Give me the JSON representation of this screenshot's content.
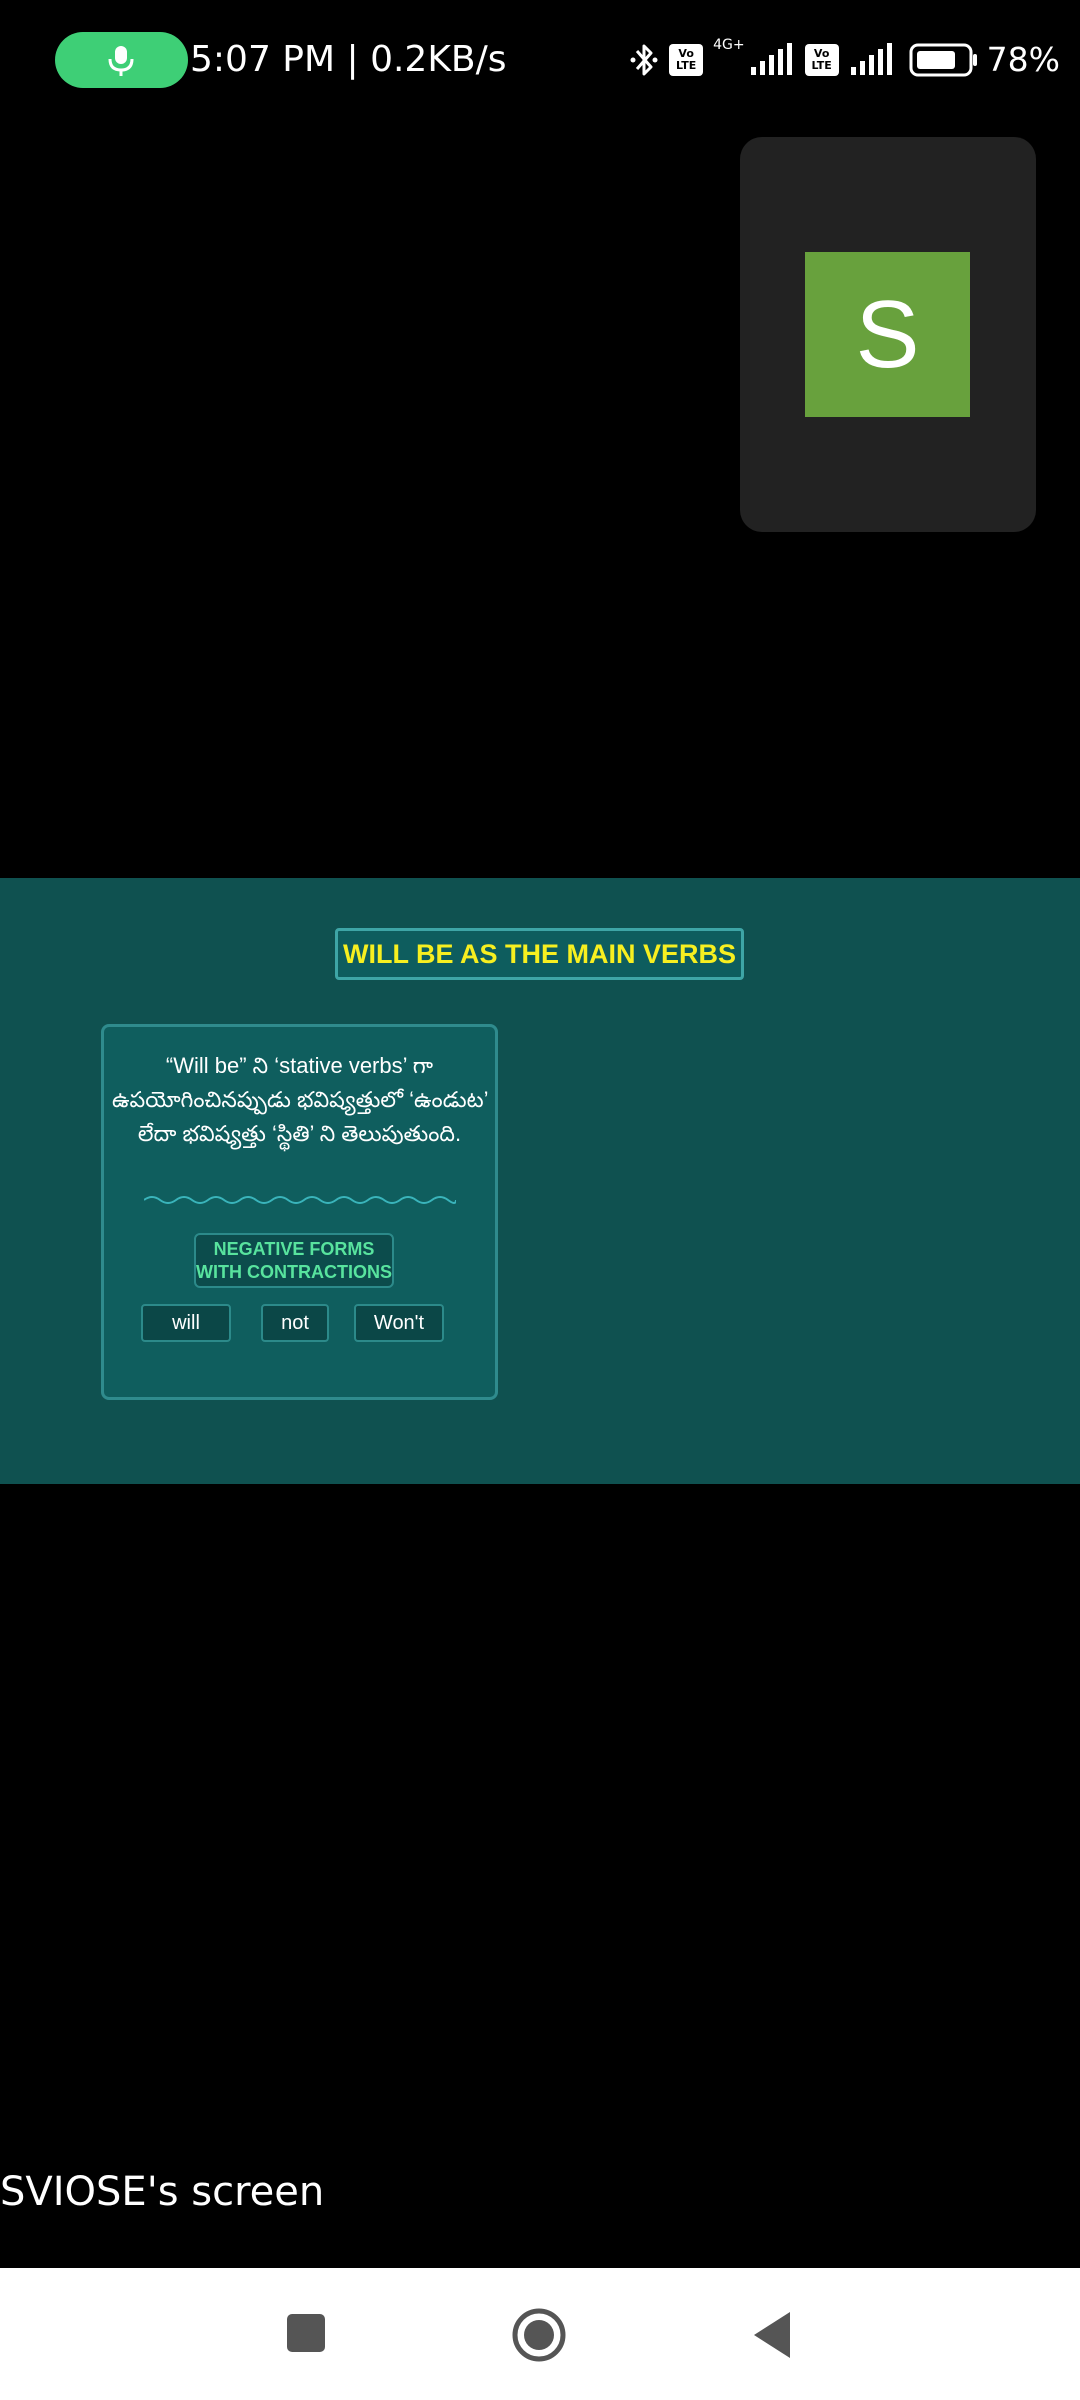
{
  "status_bar": {
    "time_speed": "5:07 PM | 0.2KB/s",
    "network_label": "4G+",
    "volte_label": "Vo LTE",
    "battery_text": "78%",
    "mic_color": "#3ecf76"
  },
  "participant": {
    "avatar_letter": "S",
    "avatar_color": "#68a13d"
  },
  "shared_screen": {
    "title": "WILL BE AS THE MAIN VERBS",
    "title_color": "#f7ef20",
    "card_lines": [
      "“Will be” ని ‘stative verbs’ గా",
      "ఉపయోగించినప్పుడు భవిష్యత్తులో ‘ఉండుట’",
      "లేదా భవిష్యత్తు ‘స్థితి’ ని తెలుపుతుంది."
    ],
    "negative_forms_line1": "NEGATIVE FORMS",
    "negative_forms_line2": "WITH CONTRACTIONS",
    "words": [
      "will",
      "not",
      "Won't"
    ]
  },
  "screen_owner_label": "SVIOSE's screen",
  "nav_bar": {
    "icons": [
      "recents-icon",
      "home-icon",
      "back-icon"
    ]
  }
}
